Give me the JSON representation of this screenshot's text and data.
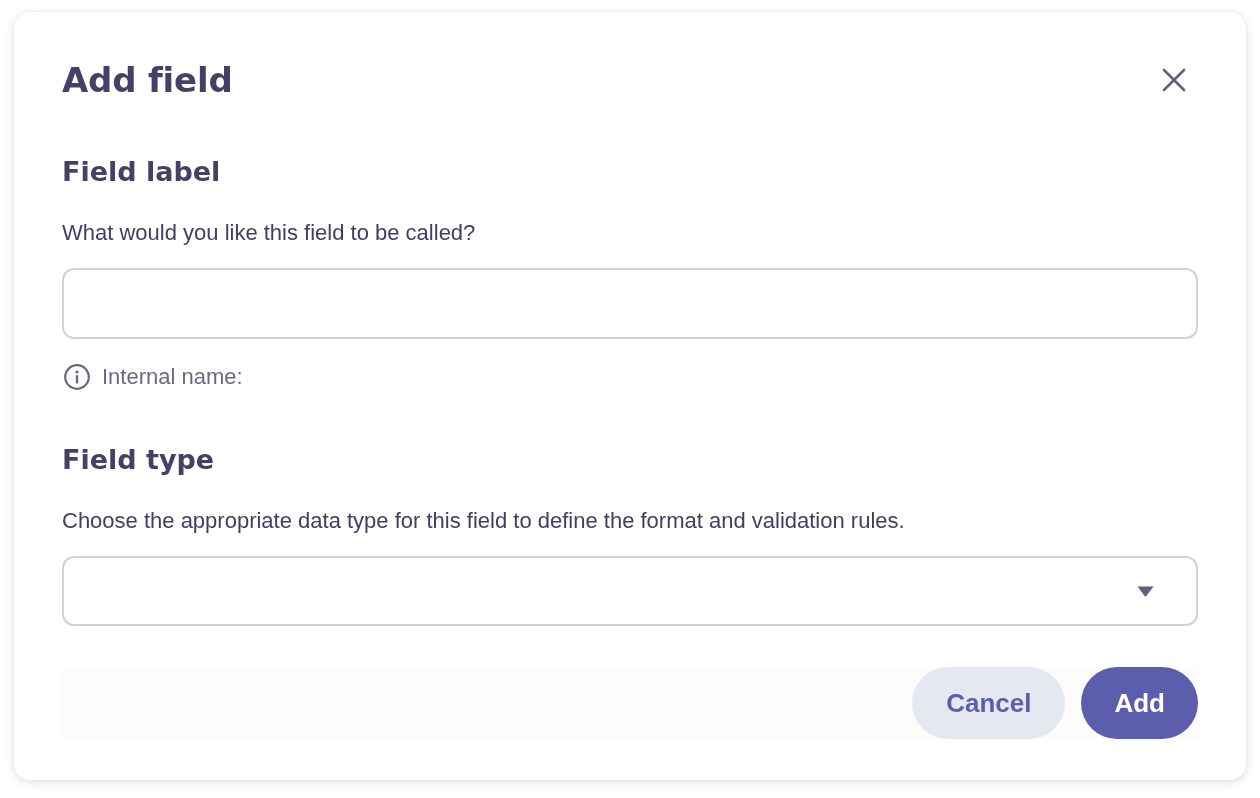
{
  "dialog": {
    "title": "Add field",
    "sections": [
      {
        "kind": "text",
        "heading": "Field label",
        "description": "What would you like this field to be called?",
        "hint": "Internal name:"
      },
      {
        "kind": "select",
        "heading": "Field type",
        "description": "Choose the appropriate data type for this field to define the format and validation rules."
      }
    ],
    "buttons": [
      {
        "label": "Cancel",
        "kind": "secondary"
      },
      {
        "label": "Add",
        "kind": "primary"
      }
    ]
  }
}
